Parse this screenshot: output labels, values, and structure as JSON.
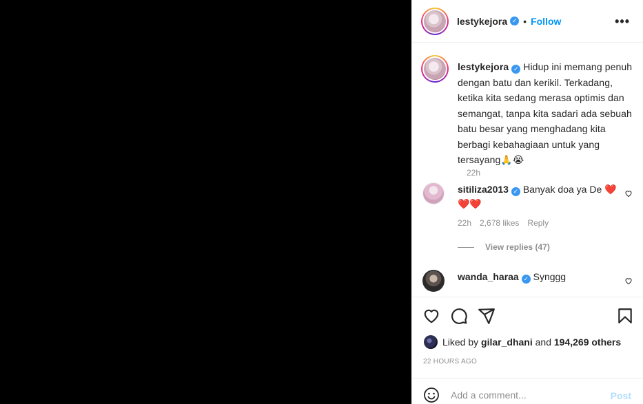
{
  "post": {
    "username": "lestykejora",
    "follow_label": "Follow",
    "separator": "•",
    "more_label": "•••"
  },
  "caption": {
    "username": "lestykejora",
    "text": "Hidup ini memang penuh dengan batu dan kerikil. Terkadang, ketika kita sedang merasa optimis dan semangat, tanpa kita sadari ada sebuah batu besar yang menghadang kita berbagi kebahagiaan untuk yang tersayang🙏😭",
    "time": "22h"
  },
  "comments": [
    {
      "username": "sitiliza2013",
      "text": "Banyak doa ya De ❤️ ❤️❤️",
      "time": "22h",
      "likes": "2,678 likes",
      "reply_label": "Reply",
      "view_replies": "View replies (47)"
    },
    {
      "username": "wanda_haraa",
      "text": "Synggg"
    }
  ],
  "likes": {
    "prefix": "Liked by",
    "liker": "gilar_dhani",
    "conjunction": "and",
    "others": "194,269 others"
  },
  "post_time": "22 HOURS AGO",
  "add_comment": {
    "placeholder": "Add a comment...",
    "post_label": "Post"
  },
  "colors": {
    "accent": "#0095f6",
    "verified": "#3897f0",
    "muted": "#8e8e8e",
    "post_disabled": "#b2dffc"
  }
}
